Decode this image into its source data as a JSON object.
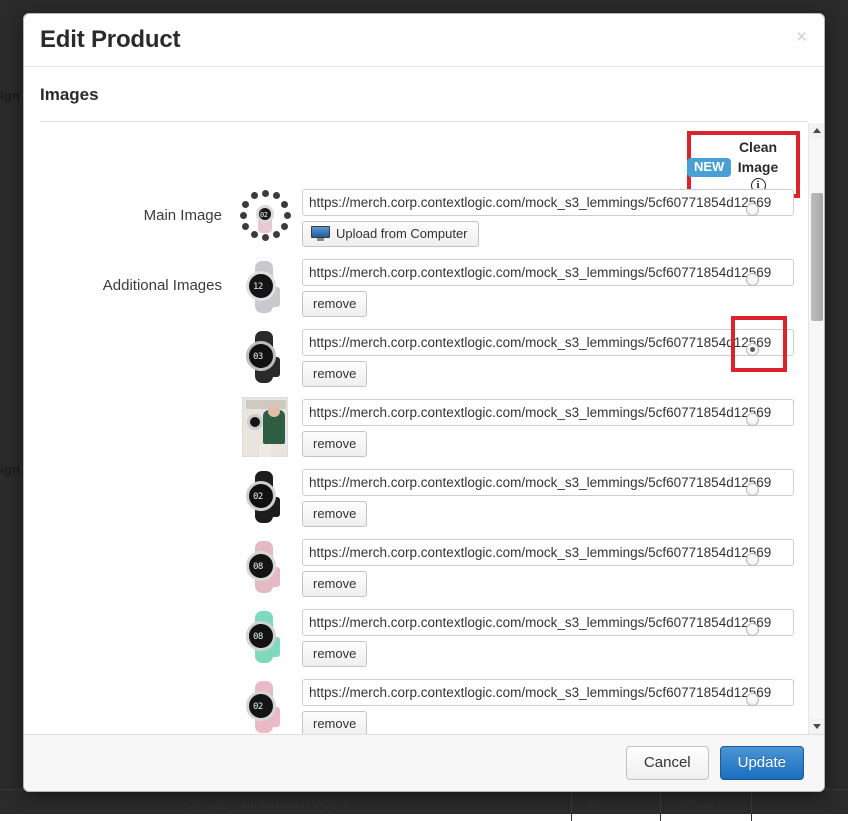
{
  "modal": {
    "title": "Edit Product",
    "close_label": "×",
    "section_title": "Images",
    "clean_image": {
      "badge": "NEW",
      "label_line1": "Clean",
      "label_line2": "Image",
      "info_icon": "info-icon"
    },
    "labels": {
      "main_image": "Main Image",
      "additional_images": "Additional Images"
    },
    "upload_button": "Upload from Computer",
    "remove_button": "remove",
    "url_value": "https://merch.corp.contextlogic.com/mock_s3_lemmings/5cf60771854d12569",
    "footer": {
      "cancel": "Cancel",
      "update": "Update"
    }
  },
  "rows": [
    {
      "kind": "main",
      "label": "Main Image",
      "url": "https://merch.corp.contextlogic.com/mock_s3_lemmings/5cf60771854d12569",
      "clean_selected": false,
      "action": "Upload from Computer"
    },
    {
      "kind": "additional",
      "label": "Additional Images",
      "url": "https://merch.corp.contextlogic.com/mock_s3_lemmings/5cf60771854d12569",
      "clean_selected": false,
      "action": "remove"
    },
    {
      "kind": "additional",
      "label": "",
      "url": "https://merch.corp.contextlogic.com/mock_s3_lemmings/5cf60771854d12569",
      "clean_selected": true,
      "action": "remove"
    },
    {
      "kind": "additional",
      "label": "",
      "url": "https://merch.corp.contextlogic.com/mock_s3_lemmings/5cf60771854d12569",
      "clean_selected": false,
      "action": "remove"
    },
    {
      "kind": "additional",
      "label": "",
      "url": "https://merch.corp.contextlogic.com/mock_s3_lemmings/5cf60771854d12569",
      "clean_selected": false,
      "action": "remove"
    },
    {
      "kind": "additional",
      "label": "",
      "url": "https://merch.corp.contextlogic.com/mock_s3_lemmings/5cf60771854d12569",
      "clean_selected": false,
      "action": "remove"
    },
    {
      "kind": "additional",
      "label": "",
      "url": "https://merch.corp.contextlogic.com/mock_s3_lemmings/5cf60771854d12569",
      "clean_selected": false,
      "action": "remove"
    },
    {
      "kind": "additional",
      "label": "",
      "url": "https://merch.corp.contextlogic.com/mock_s3_lemmings/5cf60771854d12569",
      "clean_selected": false,
      "action": "remove"
    }
  ],
  "background": {
    "left_text_top": "ign",
    "left_text_bottom": "ign",
    "table_row": {
      "sku": "Q1-p22_black&green\"\\(Q1-5\"",
      "quantity": "40",
      "price": "275.44",
      "extra": "0"
    }
  },
  "colors": {
    "highlight_red": "#d9232d",
    "badge_blue": "#4a9fd5",
    "primary_blue": "#1a6fc0",
    "backdrop": "#2b2b2b"
  }
}
